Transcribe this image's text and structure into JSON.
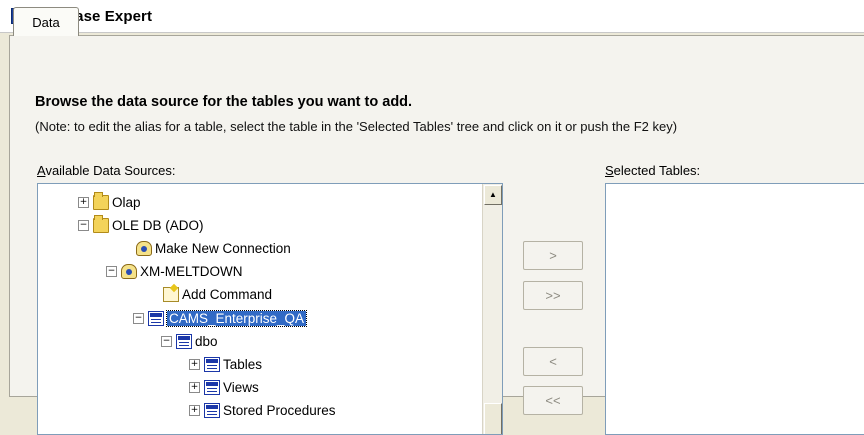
{
  "window": {
    "title": "Database Expert"
  },
  "tab": {
    "label": "Data"
  },
  "heading": "Browse the data source for the tables you want to add.",
  "note": "(Note: to edit the alias for a table, select the table in the 'Selected Tables' tree and click on it or push the F2 key)",
  "available": {
    "label_key": "A",
    "label_rest": "vailable Data Sources:"
  },
  "selected_tables": {
    "label_key": "S",
    "label_rest": "elected Tables:"
  },
  "tree": [
    {
      "label": "Olap",
      "icon": "folder-icon",
      "expander": "+"
    },
    {
      "label": "OLE DB (ADO)",
      "icon": "folder-icon",
      "expander": "−"
    },
    {
      "label": "Make New Connection",
      "icon": "new-connection-icon",
      "expander": ""
    },
    {
      "label": "XM-MELTDOWN",
      "icon": "database-icon",
      "expander": "−"
    },
    {
      "label": "Add Command",
      "icon": "add-command-icon",
      "expander": ""
    },
    {
      "label": "CAMS_Enterprise_QA",
      "icon": "table-icon",
      "expander": "−",
      "selected": true
    },
    {
      "label": "dbo",
      "icon": "table-icon",
      "expander": "−"
    },
    {
      "label": "Tables",
      "icon": "table-icon",
      "expander": "+"
    },
    {
      "label": "Views",
      "icon": "table-icon",
      "expander": "+"
    },
    {
      "label": "Stored Procedures",
      "icon": "table-icon",
      "expander": "+"
    }
  ],
  "buttons": {
    "add": ">",
    "add_all": ">>",
    "remove": "<",
    "remove_all": "<<"
  },
  "colors": {
    "selection": "#316ac5",
    "dialog_background": "#ece9d8"
  }
}
